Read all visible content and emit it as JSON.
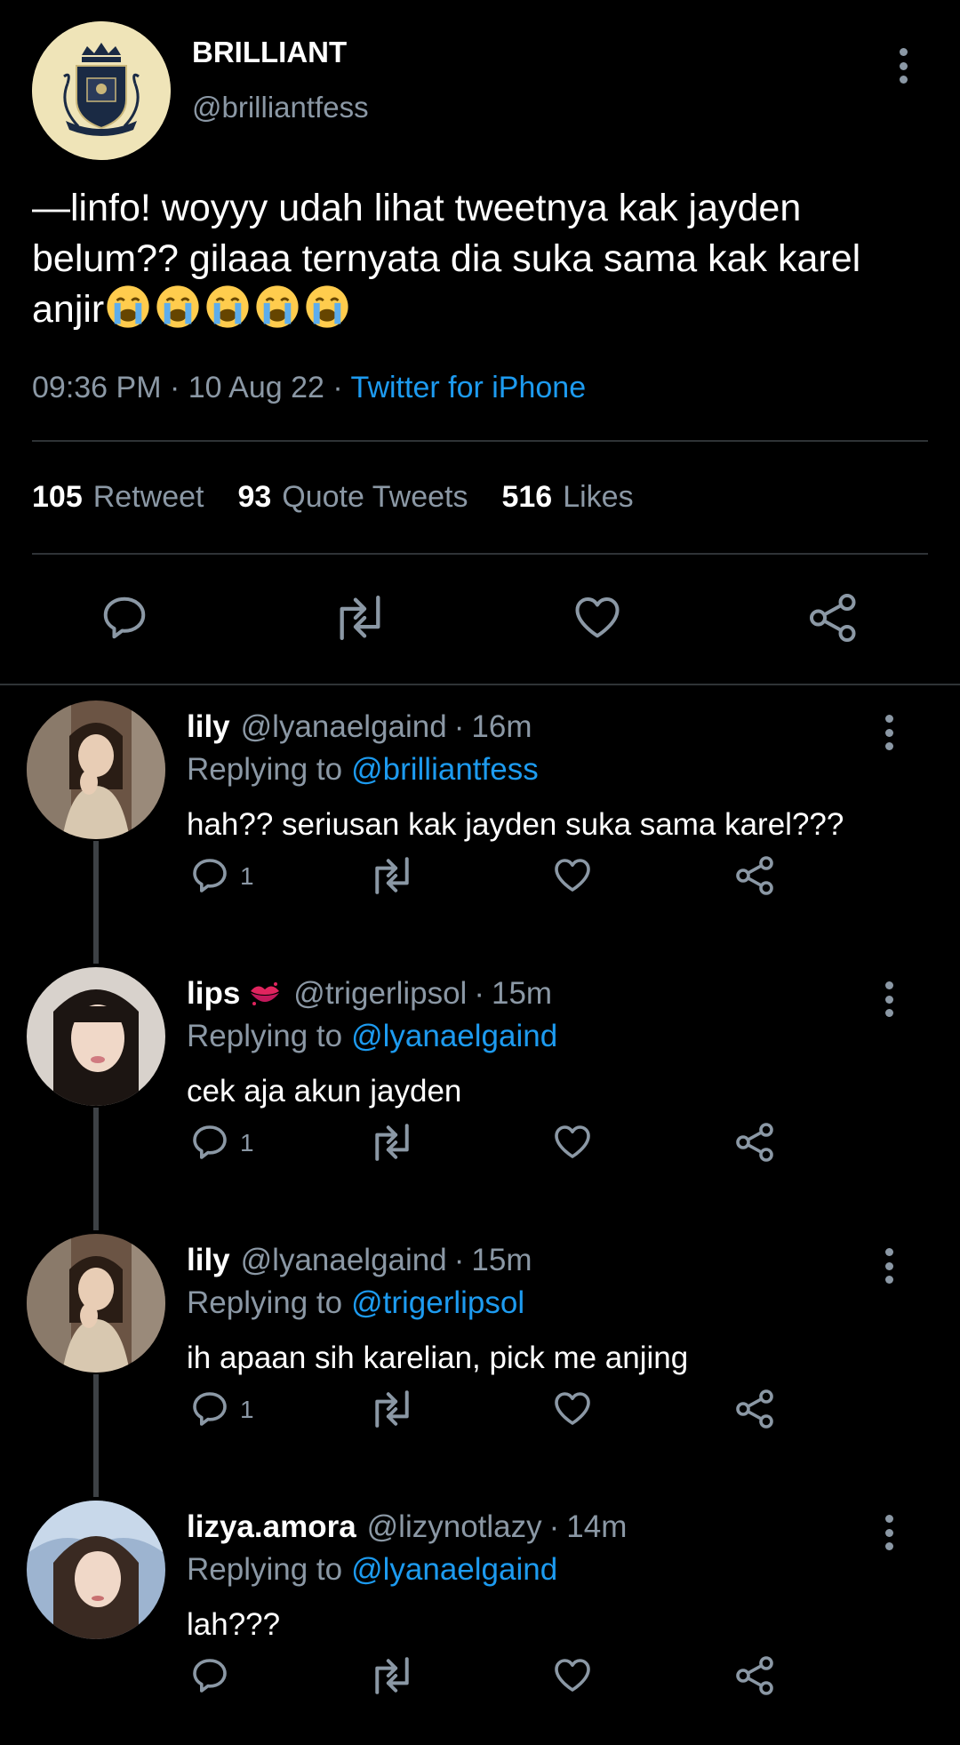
{
  "tweet": {
    "author_name": "BRILLIANT",
    "author_handle": "@brilliantfess",
    "text": "—linfo! woyyy udah lihat tweetnya kak jayden belum?? gilaaa ternyata dia suka sama kak karel anjir",
    "emoji_count": 5,
    "emoji": "loudly-crying-face",
    "time": "09:36 PM",
    "date": "10 Aug 22",
    "source": "Twitter for iPhone",
    "sep": "·"
  },
  "stats": {
    "retweets_count": "105",
    "retweets_label": "Retweet",
    "quotes_count": "93",
    "quotes_label": "Quote Tweets",
    "likes_count": "516",
    "likes_label": "Likes"
  },
  "replying_label": "Replying to",
  "replies": [
    {
      "name": "lily",
      "handle": "@lyanaelgaind",
      "time": "16m",
      "replying_to": "@brilliantfess",
      "text": "hah?? seriusan kak jayden suka sama karel???",
      "reply_count": "1"
    },
    {
      "name": "lips",
      "name_emoji": "kiss-mark",
      "handle": "@trigerlipsol",
      "time": "15m",
      "replying_to": "@lyanaelgaind",
      "text": "cek aja akun jayden",
      "reply_count": "1"
    },
    {
      "name": "lily",
      "handle": "@lyanaelgaind",
      "time": "15m",
      "replying_to": "@trigerlipsol",
      "text": "ih apaan sih karelian, pick me anjing",
      "reply_count": "1"
    },
    {
      "name": "lizya.amora",
      "handle": "@lizynotlazy",
      "time": "14m",
      "replying_to": "@lyanaelgaind",
      "text": "lah???",
      "reply_count": ""
    }
  ],
  "colors": {
    "background": "#000000",
    "text": "#ffffff",
    "muted": "#8b98a5",
    "link": "#1d9bf0",
    "divider": "#2f3336"
  }
}
